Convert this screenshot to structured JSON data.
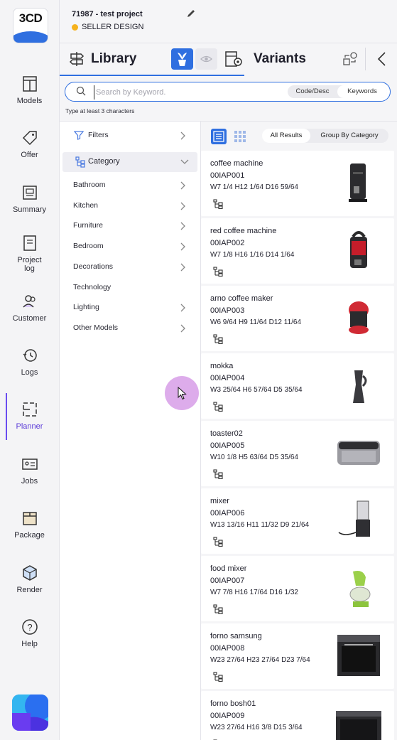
{
  "header": {
    "project_title": "71987 - test project",
    "status_label": "SELLER DESIGN",
    "status_color": "#f6b21c"
  },
  "nav": {
    "logo_text": "3CD",
    "items": [
      {
        "label": "Models",
        "icon": "models-icon"
      },
      {
        "label": "Offer",
        "icon": "offer-tag-icon"
      },
      {
        "label": "Summary",
        "icon": "summary-icon"
      },
      {
        "label": "Project\nlog",
        "icon": "project-log-icon"
      },
      {
        "label": "Customer",
        "icon": "customer-icon"
      },
      {
        "label": "Logs",
        "icon": "logs-history-icon"
      },
      {
        "label": "Planner",
        "icon": "planner-icon",
        "active": true
      },
      {
        "label": "Jobs",
        "icon": "jobs-icon"
      },
      {
        "label": "Package",
        "icon": "package-icon"
      },
      {
        "label": "Render",
        "icon": "render-cube-icon"
      },
      {
        "label": "Help",
        "icon": "help-icon"
      }
    ],
    "accent": "#6a4cf0"
  },
  "tabs": {
    "library": "Library",
    "variants": "Variants"
  },
  "search": {
    "placeholder": "Search by Keyword.",
    "value": "",
    "mode_options": [
      "Code/Desc",
      "Keywords"
    ],
    "selected_mode": "Keywords",
    "hint": "Type at least 3 characters"
  },
  "filters": {
    "filters_label": "Filters",
    "category_label": "Category",
    "categories": [
      "Bathroom",
      "Kitchen",
      "Furniture",
      "Bedroom",
      "Decorations",
      "Technology",
      "Lighting",
      "Other Models"
    ]
  },
  "results": {
    "group_options": [
      "All Results",
      "Group By Category"
    ],
    "selected_group": "All Results",
    "items": [
      {
        "name": "coffee machine",
        "code": "00IAP001",
        "dims": "W7 1/4 H12 1/64 D16 59/64"
      },
      {
        "name": "red coffee machine",
        "code": "00IAP002",
        "dims": "W7 1/8 H16 1/16 D14 1/64"
      },
      {
        "name": "arno coffee maker",
        "code": "00IAP003",
        "dims": "W6 9/64 H9 11/64 D12 11/64"
      },
      {
        "name": "mokka",
        "code": "00IAP004",
        "dims": "W3 25/64 H6 57/64 D5 35/64"
      },
      {
        "name": "toaster02",
        "code": "00IAP005",
        "dims": "W10 1/8 H5 63/64 D5 35/64"
      },
      {
        "name": "mixer",
        "code": "00IAP006",
        "dims": "W13 13/16 H11 11/32 D9 21/64"
      },
      {
        "name": "food mixer",
        "code": "00IAP007",
        "dims": "W7 7/8 H16 17/64 D16 1/32"
      },
      {
        "name": "forno samsung",
        "code": "00IAP008",
        "dims": "W23 27/64 H23 27/64 D23 7/64"
      },
      {
        "name": "forno bosh01",
        "code": "00IAP009",
        "dims": "W23 27/64 H16 3/8 D15 3/64"
      }
    ]
  }
}
